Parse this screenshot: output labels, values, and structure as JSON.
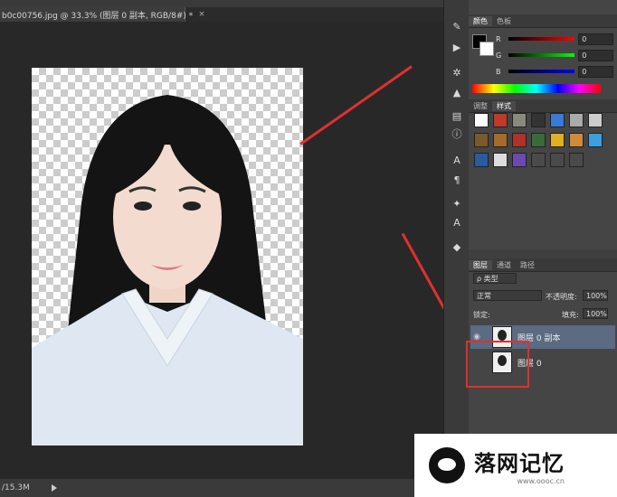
{
  "document_tab": {
    "title": "b0c00756.jpg @ 33.3% (图层 0 副本, RGB/8#) *",
    "close": "×"
  },
  "status": {
    "zoom_info": "/15.3M"
  },
  "colors": {
    "accent_red": "#e03030",
    "rows": [
      {
        "label": "R",
        "value": "0"
      },
      {
        "label": "G",
        "value": "0"
      },
      {
        "label": "B",
        "value": "0"
      }
    ]
  },
  "panel_tabs": {
    "color": [
      "颜色",
      "色板"
    ],
    "adjust": [
      "调整",
      "样式"
    ],
    "layers": [
      "图层",
      "通道",
      "路径"
    ]
  },
  "layers_panel": {
    "filter_type": "ρ 类型",
    "blend_mode": "正常",
    "opacity_label": "不透明度:",
    "opacity_value": "100%",
    "lock_label": "锁定:",
    "fill_label": "填充:",
    "fill_value": "100%",
    "layers": [
      {
        "name": "图层 0 副本",
        "visible": true,
        "selected": true
      },
      {
        "name": "图层 0",
        "visible": false,
        "selected": false
      }
    ]
  },
  "watermark": {
    "text": "落网记忆",
    "url": "www.oooc.cn"
  },
  "icons": [
    "eye-icon",
    "brush-icon",
    "play-icon",
    "gear-icon",
    "levels-icon",
    "info-icon",
    "text-icon",
    "cube-icon"
  ]
}
